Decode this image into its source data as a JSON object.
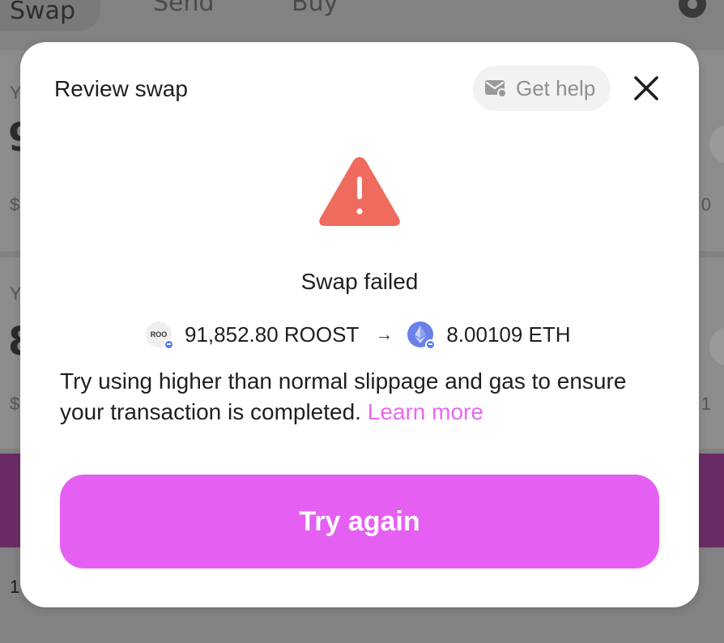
{
  "background": {
    "tabs": [
      "Swap",
      "Send",
      "Buy"
    ],
    "card1_edge_char": "9",
    "card1_label_char": "Y",
    "card1_usd_char": "$",
    "card1_right_char": "0",
    "card2_edge_char": "8",
    "card2_label_char": "Y",
    "card2_usd_char": "$",
    "card2_right_char": "1",
    "footer_char": "1"
  },
  "modal": {
    "title": "Review swap",
    "help_label": "Get help",
    "status_title": "Swap failed",
    "from_token": {
      "icon_text": "ROO",
      "amount": "91,852.80 ROOST"
    },
    "arrow": "→",
    "to_token": {
      "amount": "8.00109 ETH"
    },
    "message": "Try using higher than normal slippage and gas to ensure your transaction is completed.",
    "learn_more": "Learn more",
    "primary_button": "Try again"
  },
  "colors": {
    "accent": "#e65ff3",
    "link": "#e868ee",
    "warning": "#ee6b5d",
    "eth": "#6b80e8"
  }
}
